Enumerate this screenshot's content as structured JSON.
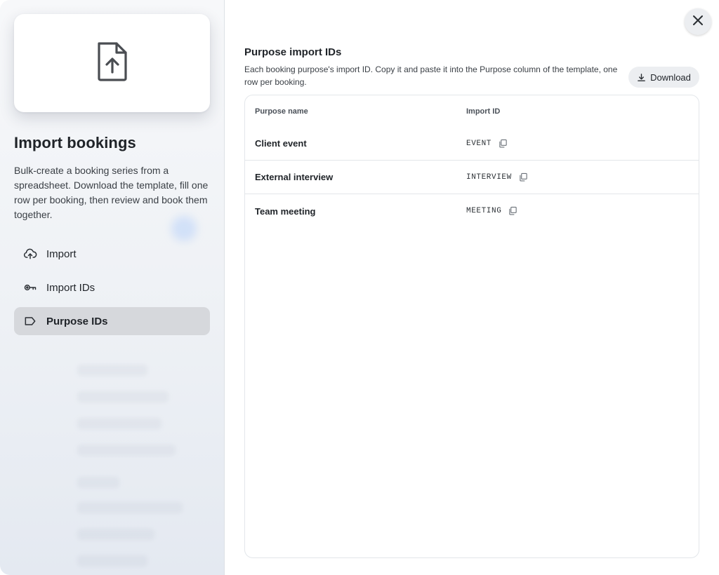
{
  "sidebar": {
    "title": "Import bookings",
    "description": "Bulk-create a booking series from a spreadsheet. Download the template, fill one row per booking, then review and book them together.",
    "items": [
      {
        "label": "Import",
        "icon": "cloud-upload-icon",
        "active": false
      },
      {
        "label": "Import IDs",
        "icon": "key-icon",
        "active": false
      },
      {
        "label": "Purpose IDs",
        "icon": "tag-icon",
        "active": true
      }
    ]
  },
  "main": {
    "title": "Purpose import IDs",
    "description": "Each booking purpose's import ID. Copy it and paste it into the Purpose column of the template, one row per booking.",
    "download_label": "Download",
    "table": {
      "headers": [
        "Purpose name",
        "Import ID"
      ],
      "rows": [
        {
          "name": "Client event",
          "id": "EVENT"
        },
        {
          "name": "External interview",
          "id": "INTERVIEW"
        },
        {
          "name": "Team meeting",
          "id": "MEETING"
        }
      ]
    }
  },
  "colors": {
    "active_nav": "#d6d8dc",
    "button_bg": "#eceef1",
    "text": "#1f2328"
  }
}
